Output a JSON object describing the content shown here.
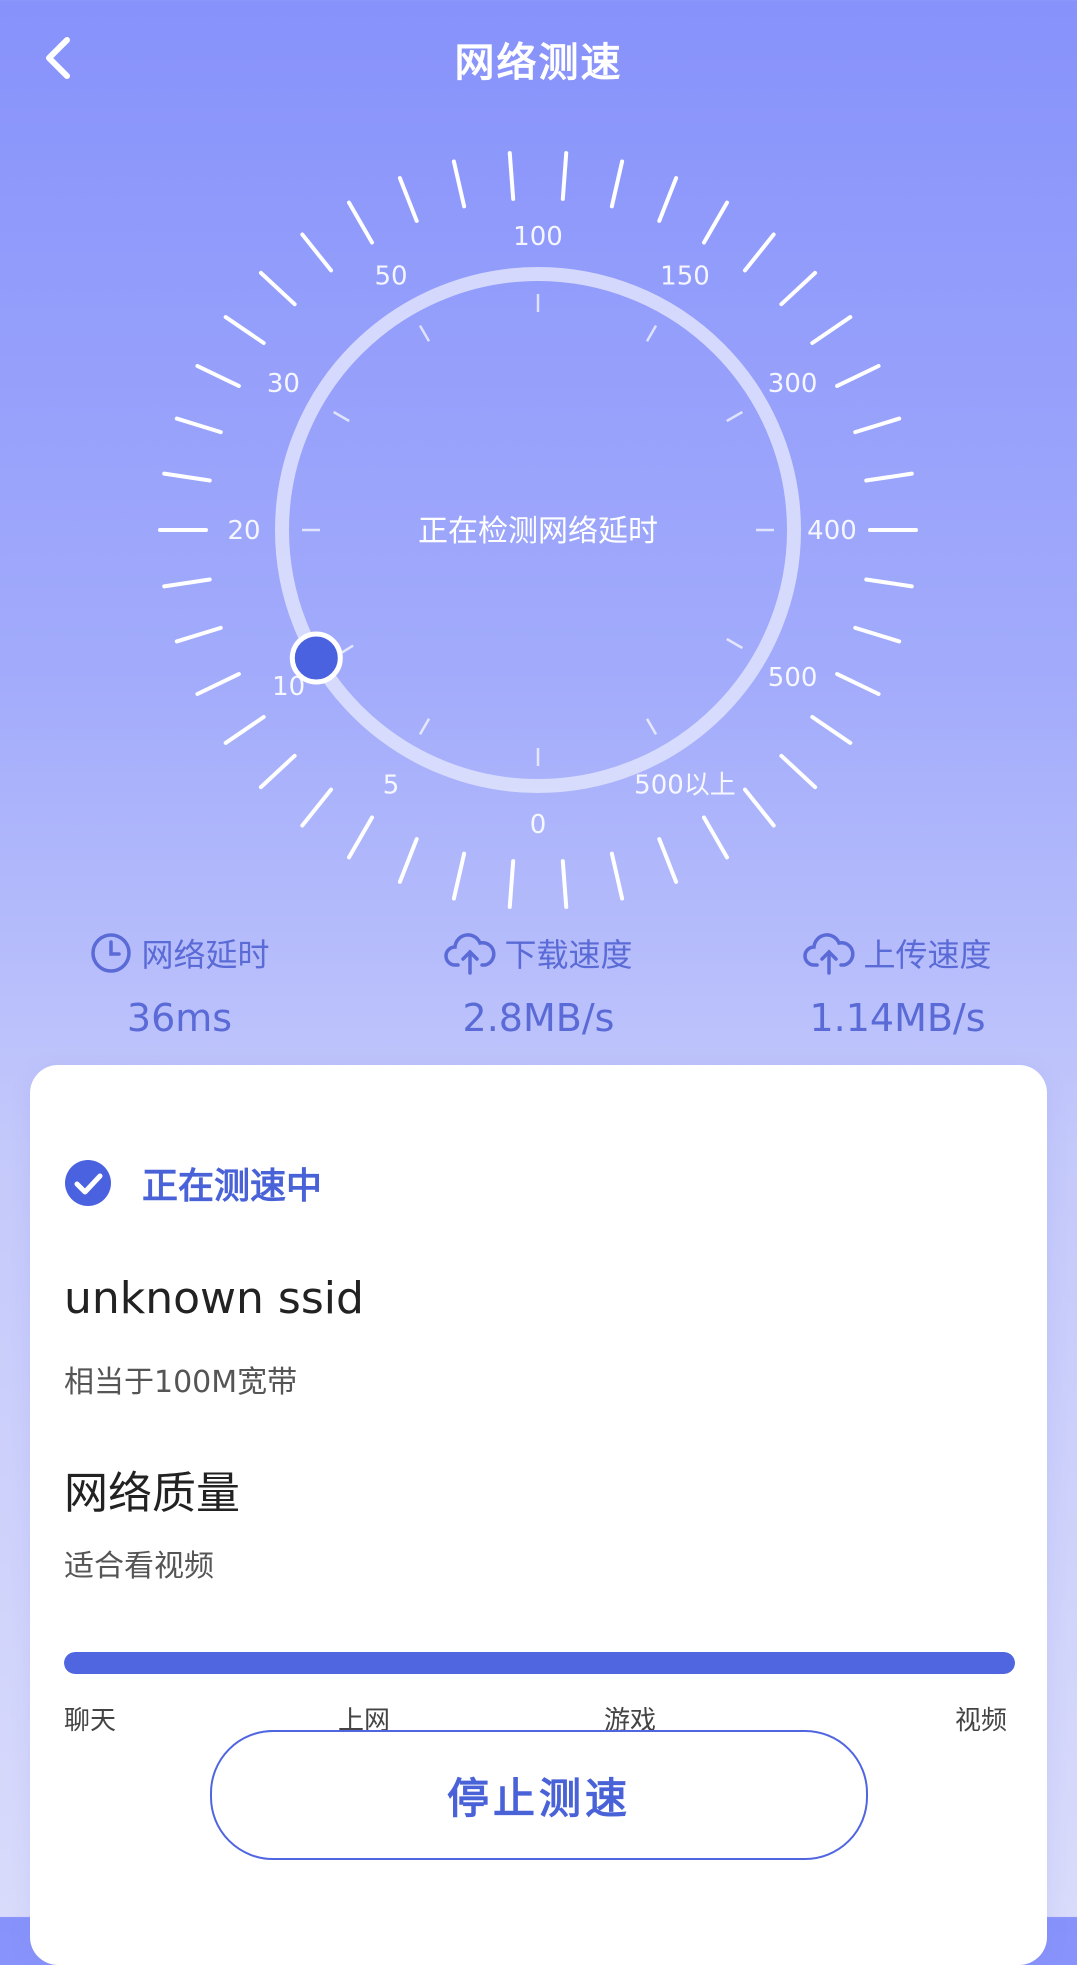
{
  "header": {
    "title": "网络测速",
    "back_icon": "chevron-left-icon"
  },
  "gauge": {
    "center_text": "正在检测网络延时",
    "scale_labels": [
      "0",
      "5",
      "10",
      "20",
      "30",
      "50",
      "100",
      "150",
      "300",
      "400",
      "500",
      "500以上"
    ],
    "progress": 0.04,
    "colors": {
      "ring": "#dfe3fd",
      "knob": "#4a62e0",
      "tick": "#ffffff"
    }
  },
  "stats": [
    {
      "label": "网络延时",
      "value": "36ms",
      "icon": "clock-icon"
    },
    {
      "label": "下载速度",
      "value": "2.8MB/s",
      "icon": "cloud-upload-icon"
    },
    {
      "label": "上传速度",
      "value": "1.14MB/s",
      "icon": "cloud-upload-icon"
    }
  ],
  "card": {
    "status": "正在测速中",
    "ssid": "unknown ssid",
    "bandwidth": "相当于100M宽带",
    "quality_title": "网络质量",
    "quality_desc": "适合看视频",
    "quality_progress": 1.0,
    "quality_levels": [
      "聊天",
      "上网",
      "游戏",
      "视频"
    ],
    "stop_button": "停止测速"
  },
  "colors": {
    "accent": "#5066e0",
    "text_blue": "#5a6ad6"
  }
}
